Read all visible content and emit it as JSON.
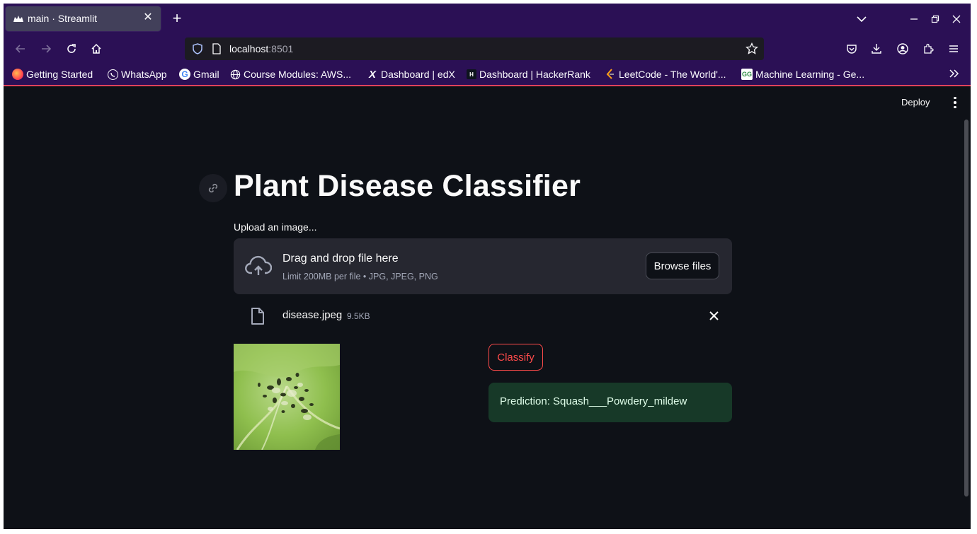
{
  "browser": {
    "tab": {
      "title": "main · Streamlit",
      "favicon": "streamlit-crown-icon"
    },
    "url": {
      "host": "localhost",
      "port": ":8501"
    },
    "bookmarks": [
      {
        "label": "Getting Started",
        "icon": "firefox-icon"
      },
      {
        "label": "WhatsApp",
        "icon": "whatsapp-icon"
      },
      {
        "label": "Gmail",
        "icon": "google-icon"
      },
      {
        "label": "Course Modules: AWS...",
        "icon": "globe-icon"
      },
      {
        "label": "Dashboard | edX",
        "icon": "edx-icon"
      },
      {
        "label": "Dashboard | HackerRank",
        "icon": "hackerrank-icon"
      },
      {
        "label": "LeetCode - The World'...",
        "icon": "leetcode-icon"
      },
      {
        "label": "Machine Learning - Ge...",
        "icon": "geeksforgeeks-icon"
      }
    ],
    "colors": {
      "chrome": "#2b1055",
      "accent_line": "#e0425b"
    }
  },
  "app": {
    "toolbar": {
      "deploy_label": "Deploy"
    },
    "title": "Plant Disease Classifier",
    "uploader": {
      "label": "Upload an image...",
      "drag_text": "Drag and drop file here",
      "limit_text": "Limit 200MB per file • JPG, JPEG, PNG",
      "browse_label": "Browse files"
    },
    "file": {
      "name": "disease.jpeg",
      "size": "9.5KB"
    },
    "classify_label": "Classify",
    "prediction": "Prediction: Squash___Powdery_mildew",
    "colors": {
      "background": "#0e1117",
      "primary": "#ff4b4b",
      "success_bg": "#173928"
    }
  }
}
